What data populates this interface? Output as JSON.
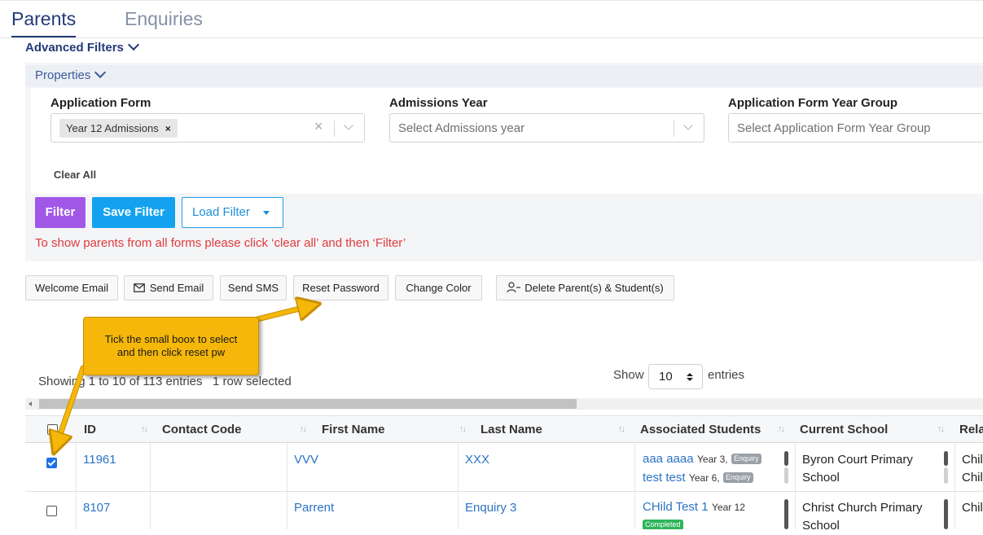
{
  "tabs": {
    "active": "Parents",
    "inactive": "Enquiries"
  },
  "filters": {
    "advanced_label": "Advanced Filters",
    "properties_label": "Properties",
    "application_form": {
      "label": "Application Form",
      "chip": "Year 12 Admissions",
      "chip_remove": "×",
      "clear": "×"
    },
    "admissions_year": {
      "label": "Admissions Year",
      "placeholder": "Select Admissions year"
    },
    "year_group": {
      "label": "Application Form Year Group",
      "placeholder": "Select Application Form Year Group"
    },
    "clear_all": "Clear All",
    "filter_btn": "Filter",
    "save_filter_btn": "Save Filter",
    "load_filter_btn": "Load Filter",
    "warning": "To show parents from all forms please click ‘clear all’ and then ‘Filter’"
  },
  "actions": {
    "welcome_email": "Welcome Email",
    "send_email": "Send Email",
    "send_sms": "Send SMS",
    "reset_password": "Reset Password",
    "change_color": "Change Color",
    "delete": "Delete Parent(s) & Student(s)"
  },
  "annotation": {
    "line1": "Tick the small boox to select",
    "line2": "and then click reset pw"
  },
  "table_info": {
    "showing": "Showing 1 to 10 of 113 entries",
    "selected": "1 row selected",
    "show": "Show",
    "page_length": "10",
    "entries": "entries"
  },
  "columns": [
    "ID",
    "Contact Code",
    "First Name",
    "Last Name",
    "Associated Students",
    "Current School",
    "Rela"
  ],
  "rows": [
    {
      "checked": true,
      "id": "11961",
      "contact_code": "",
      "first_name": "VVV",
      "last_name": "XXX",
      "students": [
        {
          "name": "aaa aaaa",
          "year": "Year 3,",
          "badge": "Enquiry"
        },
        {
          "name": "test test",
          "year": "Year 6,",
          "badge": "Enquiry"
        }
      ],
      "school_line1": "Byron Court Primary",
      "school_line2": "School",
      "relation": "Chil",
      "relation2": "Chil"
    },
    {
      "checked": false,
      "id": "8107",
      "contact_code": "",
      "first_name": "Parrent",
      "last_name": "Enquiry 3",
      "students": [
        {
          "name": "CHild Test 1",
          "year": "Year 12",
          "badge": "Completed"
        }
      ],
      "school_line1": "Christ Church Primary",
      "school_line2": "School",
      "relation": "Chil"
    }
  ],
  "colors": {
    "primary_navy": "#233a78",
    "filter_purple": "#a158e8",
    "save_blue": "#14a2f0",
    "link_blue": "#2b73c5",
    "warning_red": "#e0393c",
    "callout_yellow": "#f5b70a"
  }
}
